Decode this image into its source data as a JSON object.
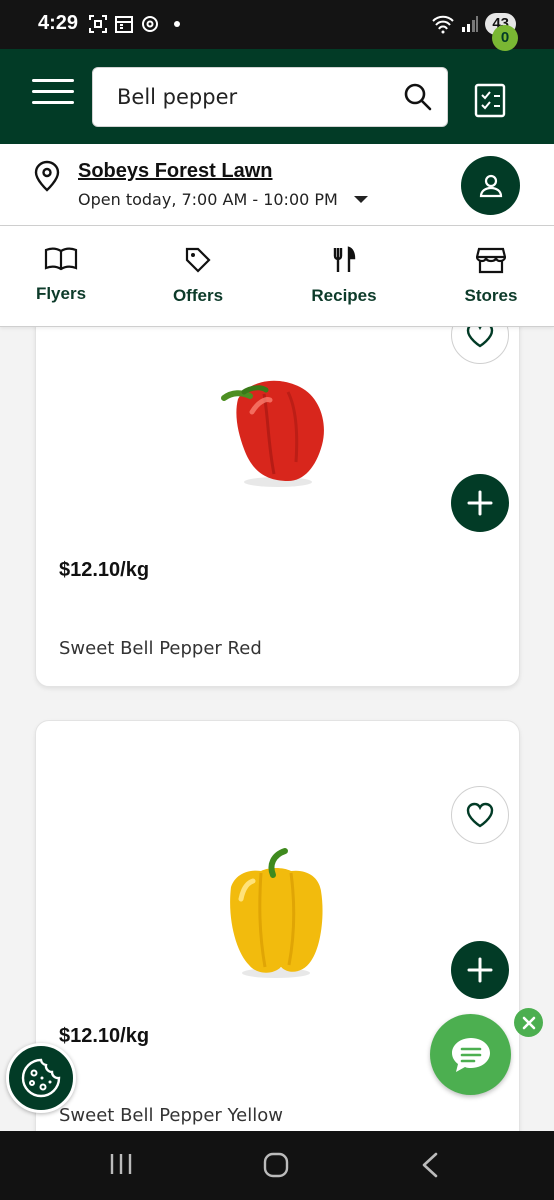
{
  "status_bar": {
    "time": "4:29",
    "battery": "43",
    "icons": [
      "screenshot-icon",
      "calendar-icon",
      "threads-icon",
      "notification-dot",
      "wifi-icon",
      "signal-icon"
    ]
  },
  "header": {
    "search_value": "Bell pepper",
    "cart_count": "0"
  },
  "store": {
    "name": "Sobeys Forest Lawn",
    "hours": "Open today, 7:00 AM - 10:00 PM"
  },
  "nav": {
    "tabs": [
      {
        "label": "Flyers",
        "icon": "book-icon"
      },
      {
        "label": "Offers",
        "icon": "tag-icon"
      },
      {
        "label": "Recipes",
        "icon": "fork-knife-icon"
      },
      {
        "label": "Stores",
        "icon": "storefront-icon"
      }
    ]
  },
  "products": [
    {
      "price": "$12.10/kg",
      "name": "Sweet Bell Pepper Red",
      "color": "#d8261c"
    },
    {
      "price": "$12.10/kg",
      "name": "Sweet Bell Pepper Yellow",
      "color": "#f2bb0d"
    }
  ],
  "colors": {
    "brand_dark_green": "#023b26",
    "badge_green": "#7ab733",
    "chat_green": "#4caf50"
  }
}
